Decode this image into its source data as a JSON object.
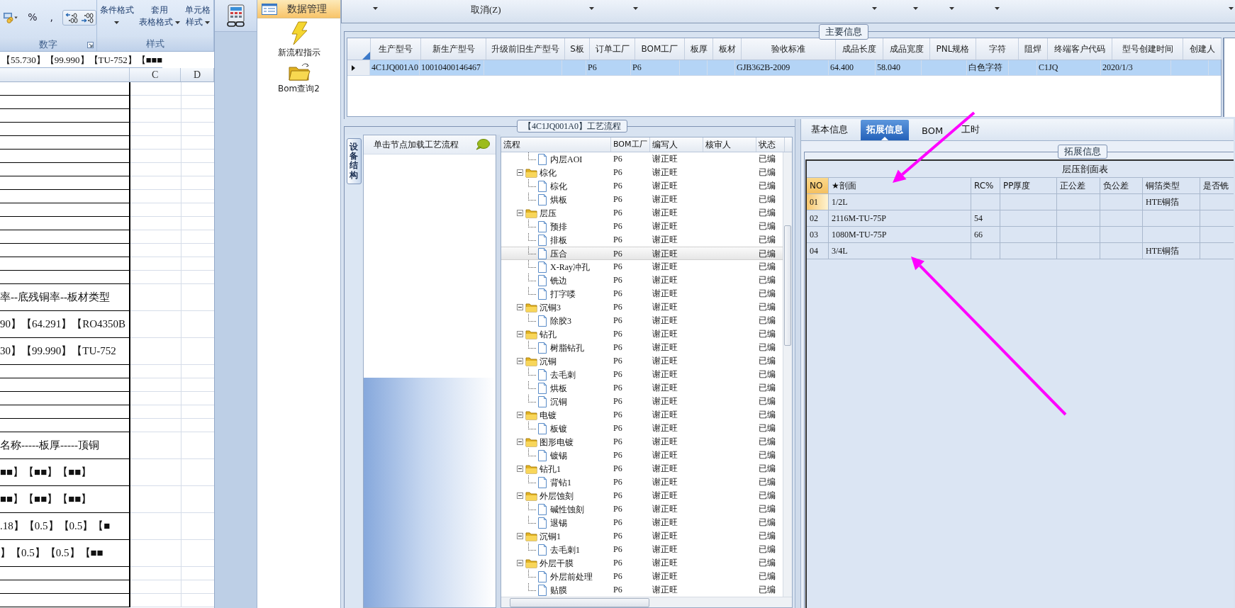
{
  "excel": {
    "number_group": {
      "label": "数字",
      "percent": "%",
      "comma": ","
    },
    "style_group": {
      "label": "样式",
      "buttons": [
        {
          "lines": [
            "条件格式"
          ],
          "dropdown": true
        },
        {
          "lines": [
            "套用",
            "表格格式"
          ],
          "dropdown": true
        },
        {
          "lines": [
            "单元格",
            "样式"
          ],
          "dropdown": true
        }
      ]
    },
    "formula_bar": "【55.730】【99.990】【TU-752】【■■■",
    "columns": [
      "C",
      "D"
    ],
    "sheet_rows": [
      {
        "kind": "short"
      },
      {
        "kind": "short"
      },
      {
        "kind": "short"
      },
      {
        "kind": "short"
      },
      {
        "kind": "short"
      },
      {
        "kind": "short"
      },
      {
        "kind": "short"
      },
      {
        "kind": "short"
      },
      {
        "kind": "short"
      },
      {
        "kind": "short"
      },
      {
        "kind": "short"
      },
      {
        "kind": "short"
      },
      {
        "kind": "short"
      },
      {
        "kind": "short"
      },
      {
        "kind": "short"
      },
      {
        "kind": "tall",
        "text": "率--底残铜率--板材类型"
      },
      {
        "kind": "tall",
        "text": "90】【64.291】【RO4350B"
      },
      {
        "kind": "tall",
        "text": "30】【99.990】【TU-752"
      },
      {
        "kind": "short"
      },
      {
        "kind": "short"
      },
      {
        "kind": "short"
      },
      {
        "kind": "short"
      },
      {
        "kind": "short"
      },
      {
        "kind": "tall",
        "text": "名称-----板厚-----顶铜"
      },
      {
        "kind": "tall",
        "text": "■■】【■■】【■■】"
      },
      {
        "kind": "tall",
        "text": "■■】【■■】【■■】"
      },
      {
        "kind": "tall",
        "text": ".18】【0.5】【0.5】【■"
      },
      {
        "kind": "tall",
        "text": "】【0.5】【0.5】【■■"
      },
      {
        "kind": "short"
      },
      {
        "kind": "short"
      },
      {
        "kind": "short"
      }
    ]
  },
  "nav": {
    "header": {
      "label": "数据管理",
      "selected": true
    },
    "items": [
      {
        "label": "新流程指示",
        "kind": "lightning"
      },
      {
        "label": "Bom查询2",
        "kind": "folder"
      }
    ]
  },
  "toolbar": {
    "cancel_label": "取消(Z)"
  },
  "main_info": {
    "title": "主要信息",
    "columns": [
      "生产型号",
      "新生产型号",
      "升级前旧生产型号",
      "S板",
      "订单工厂",
      "BOM工厂",
      "板厚",
      "板材",
      "验收标准",
      "成品长度",
      "成品宽度",
      "PNL规格",
      "字符",
      "阻焊",
      "终端客户代码",
      "型号创建时间",
      "创建人"
    ],
    "rows": [
      {
        "selected": true,
        "cells": [
          "4C1JQ001A0",
          "10010400146467",
          null,
          null,
          "P6",
          "P6",
          null,
          null,
          "GJB362B-2009",
          "64.400",
          "58.040",
          null,
          "白色字符",
          null,
          "C1JQ",
          "2020/1/3",
          null
        ]
      }
    ]
  },
  "process": {
    "title": "【4C1JQ001A0】工艺流程",
    "side_tab": "设备结构",
    "node_hint": "单击节点加载工艺流程",
    "columns": [
      "流程",
      "BOM工厂",
      "编写人",
      "核审人",
      "状态"
    ],
    "tree": [
      {
        "children": [
          {
            "name": "内层AOI",
            "factory": "P6",
            "writer": "谢正旺",
            "status": "已编",
            "selected": false
          }
        ]
      },
      {
        "name": "棕化",
        "factory": "P6",
        "writer": "谢正旺",
        "status": "已编",
        "selected": false,
        "expanded": true,
        "children": [
          {
            "name": "棕化",
            "factory": "P6",
            "writer": "谢正旺",
            "status": "已编",
            "selected": false
          },
          {
            "name": "烘板",
            "factory": "P6",
            "writer": "谢正旺",
            "status": "已编",
            "selected": false
          }
        ]
      },
      {
        "name": "层压",
        "factory": "P6",
        "writer": "谢正旺",
        "status": "已编",
        "selected": false,
        "expanded": true,
        "children": [
          {
            "name": "预排",
            "factory": "P6",
            "writer": "谢正旺",
            "status": "已编",
            "selected": false
          },
          {
            "name": "排板",
            "factory": "P6",
            "writer": "谢正旺",
            "status": "已编",
            "selected": false
          },
          {
            "name": "压合",
            "factory": "P6",
            "writer": "谢正旺",
            "status": "已编",
            "selected": true
          },
          {
            "name": "X-Ray冲孔",
            "factory": "P6",
            "writer": "谢正旺",
            "status": "已编",
            "selected": false
          },
          {
            "name": "铣边",
            "factory": "P6",
            "writer": "谢正旺",
            "status": "已编",
            "selected": false
          },
          {
            "name": "打字喽",
            "factory": "P6",
            "writer": "谢正旺",
            "status": "已编",
            "selected": false
          }
        ]
      },
      {
        "name": "沉铜3",
        "factory": "P6",
        "writer": "谢正旺",
        "status": "已编",
        "selected": false,
        "expanded": true,
        "children": [
          {
            "name": "除胶3",
            "factory": "P6",
            "writer": "谢正旺",
            "status": "已编",
            "selected": false
          }
        ]
      },
      {
        "name": "钻孔",
        "factory": "P6",
        "writer": "谢正旺",
        "status": "已编",
        "selected": false,
        "expanded": true,
        "children": [
          {
            "name": "树脂钻孔",
            "factory": "P6",
            "writer": "谢正旺",
            "status": "已编",
            "selected": false
          }
        ]
      },
      {
        "name": "沉铜",
        "factory": "P6",
        "writer": "谢正旺",
        "status": "已编",
        "selected": false,
        "expanded": true,
        "children": [
          {
            "name": "去毛刺",
            "factory": "P6",
            "writer": "谢正旺",
            "status": "已编",
            "selected": false
          },
          {
            "name": "烘板",
            "factory": "P6",
            "writer": "谢正旺",
            "status": "已编",
            "selected": false
          },
          {
            "name": "沉铜",
            "factory": "P6",
            "writer": "谢正旺",
            "status": "已编",
            "selected": false
          }
        ]
      },
      {
        "name": "电镀",
        "factory": "P6",
        "writer": "谢正旺",
        "status": "已编",
        "selected": false,
        "expanded": true,
        "children": [
          {
            "name": "板镀",
            "factory": "P6",
            "writer": "谢正旺",
            "status": "已编",
            "selected": false
          }
        ]
      },
      {
        "name": "图形电镀",
        "factory": "P6",
        "writer": "谢正旺",
        "status": "已编",
        "selected": false,
        "expanded": true,
        "children": [
          {
            "name": "镀锡",
            "factory": "P6",
            "writer": "谢正旺",
            "status": "已编",
            "selected": false
          }
        ]
      },
      {
        "name": "钻孔1",
        "factory": "P6",
        "writer": "谢正旺",
        "status": "已编",
        "selected": false,
        "expanded": true,
        "children": [
          {
            "name": "背钻1",
            "factory": "P6",
            "writer": "谢正旺",
            "status": "已编",
            "selected": false
          }
        ]
      },
      {
        "name": "外层蚀刻",
        "factory": "P6",
        "writer": "谢正旺",
        "status": "已编",
        "selected": false,
        "expanded": true,
        "children": [
          {
            "name": "碱性蚀刻",
            "factory": "P6",
            "writer": "谢正旺",
            "status": "已编",
            "selected": false
          },
          {
            "name": "退锡",
            "factory": "P6",
            "writer": "谢正旺",
            "status": "已编",
            "selected": false
          }
        ]
      },
      {
        "name": "沉铜1",
        "factory": "P6",
        "writer": "谢正旺",
        "status": "已编",
        "selected": false,
        "expanded": true,
        "children": [
          {
            "name": "去毛刺1",
            "factory": "P6",
            "writer": "谢正旺",
            "status": "已编",
            "selected": false
          }
        ]
      },
      {
        "name": "外层干膜",
        "factory": "P6",
        "writer": "谢正旺",
        "status": "已编",
        "selected": false,
        "expanded": true,
        "children": [
          {
            "name": "外层前处理",
            "factory": "P6",
            "writer": "谢正旺",
            "status": "已编",
            "selected": false
          },
          {
            "name": "贴膜",
            "factory": "P6",
            "writer": "谢正旺",
            "status": "已编",
            "selected": false
          }
        ]
      }
    ]
  },
  "ext": {
    "tabs": [
      {
        "label": "基本信息",
        "selected": false
      },
      {
        "label": "拓展信息",
        "selected": true
      },
      {
        "label": "BOM",
        "selected": false
      },
      {
        "label": "工时",
        "selected": false
      }
    ],
    "group_title": "拓展信息",
    "table": {
      "title": "层压剖面表",
      "columns": [
        "NO",
        "★剖面",
        "RC%",
        "PP厚度",
        "正公差",
        "负公差",
        "铜箔类型",
        "是否铣"
      ],
      "rows": [
        {
          "selected": true,
          "cells": [
            "01",
            "1/2L",
            null,
            null,
            null,
            null,
            "HTE铜箔",
            null
          ]
        },
        {
          "selected": false,
          "cells": [
            "02",
            "2116M-TU-75P",
            "54",
            null,
            null,
            null,
            null,
            null
          ]
        },
        {
          "selected": false,
          "cells": [
            "03",
            "1080M-TU-75P",
            "66",
            null,
            null,
            null,
            null,
            null
          ]
        },
        {
          "selected": false,
          "cells": [
            "04",
            "3/4L",
            null,
            null,
            null,
            null,
            "HTE铜箔",
            null
          ]
        }
      ]
    }
  },
  "annotations": [
    {
      "kind": "arrow"
    },
    {
      "kind": "arrow"
    }
  ]
}
